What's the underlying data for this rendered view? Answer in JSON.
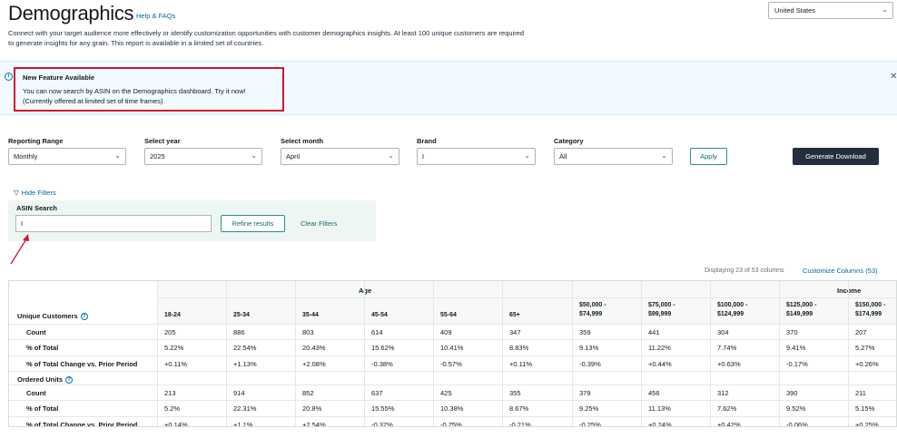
{
  "header": {
    "title": "Demographics",
    "help_link": "Help & FAQs",
    "description": "Connect with your target audience more effectively or identify customization opportunities with customer demographics insights. At least 100 unique customers are required to generate insights for any grain. This report is available in a limited set of countries.",
    "country": "United States"
  },
  "banner": {
    "title": "New Feature Available",
    "line1": "You can now search by ASIN on the Demographics dashboard. Try it now!",
    "line2": "(Currently offered at limited set of time frames)",
    "close_icon": "close-icon",
    "highlight_color": "#d0182f"
  },
  "filters": {
    "reporting_range": {
      "label": "Reporting Range",
      "value": "Monthly"
    },
    "year": {
      "label": "Select year",
      "value": "2025"
    },
    "month": {
      "label": "Select month",
      "value": "April"
    },
    "brand": {
      "label": "Brand",
      "value": "I"
    },
    "category": {
      "label": "Category",
      "value": "All"
    },
    "apply_label": "Apply",
    "download_label": "Generate Download"
  },
  "asin": {
    "hide_filters": "Hide Filters",
    "label": "ASIN Search",
    "value": "I",
    "refine_label": "Refine results",
    "clear_label": "Clear Filters"
  },
  "table_meta": {
    "displaying": "Displaying 23 of 53 columns",
    "customize": "Customize Columns (53)"
  },
  "table": {
    "groups": {
      "age": "Age",
      "income": "Income"
    },
    "columns": [
      "18-24",
      "25-34",
      "35-44",
      "45-54",
      "55-64",
      "65+",
      "$50,000 -\n$74,999",
      "$75,000 -\n$99,999",
      "$100,000 -\n$124,999",
      "$125,000 -\n$149,999",
      "$150,000 -\n$174,999"
    ],
    "sections": [
      {
        "title": "Unique Customers",
        "rows": [
          {
            "label": "Count",
            "values": [
              "205",
              "886",
              "803",
              "614",
              "409",
              "347",
              "359",
              "441",
              "304",
              "370",
              "207"
            ]
          },
          {
            "label": "% of Total",
            "values": [
              "5.22%",
              "22.54%",
              "20.43%",
              "15.62%",
              "10.41%",
              "8.83%",
              "9.13%",
              "11.22%",
              "7.74%",
              "9.41%",
              "5.27%"
            ]
          },
          {
            "label": "% of Total Change vs. Prior Period",
            "values": [
              "+0.11%",
              "+1.13%",
              "+2.08%",
              "-0.38%",
              "-0.57%",
              "+0.11%",
              "-0.39%",
              "+0.44%",
              "+0.63%",
              "-0.17%",
              "+0.26%"
            ]
          }
        ]
      },
      {
        "title": "Ordered Units",
        "rows": [
          {
            "label": "Count",
            "values": [
              "213",
              "914",
              "852",
              "637",
              "425",
              "355",
              "379",
              "456",
              "312",
              "390",
              "211"
            ]
          },
          {
            "label": "% of Total",
            "values": [
              "5.2%",
              "22.31%",
              "20.8%",
              "15.55%",
              "10.38%",
              "8.67%",
              "9.25%",
              "11.13%",
              "7.62%",
              "9.52%",
              "5.15%"
            ]
          },
          {
            "label": "% of Total Change vs. Prior Period",
            "values": [
              "+0.14%",
              "+1.1%",
              "+2.54%",
              "-0.37%",
              "-0.75%",
              "-0.21%",
              "-0.25%",
              "+0.24%",
              "+0.42%",
              "-0.06%",
              "+0.25%"
            ]
          }
        ]
      }
    ]
  }
}
